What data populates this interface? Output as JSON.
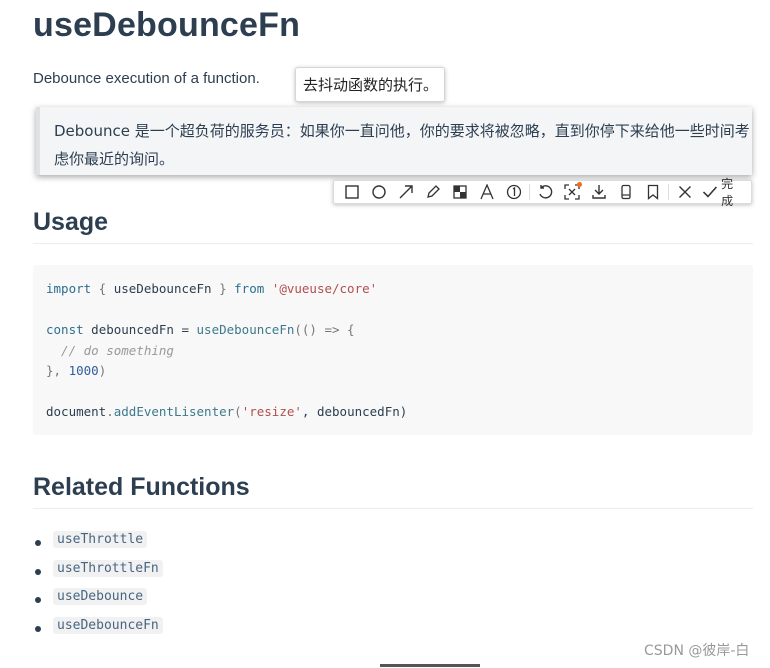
{
  "doc": {
    "title": "useDebounceFn",
    "description": "Debounce execution of a function.",
    "tooltip": "去抖动函数的执行。",
    "note": "Debounce 是一个超负荷的服务员：如果你一直问他，你的要求将被忽略，直到你停下来给他一些时间考虑你最近的询问。",
    "usage_heading": "Usage",
    "related_heading": "Related Functions",
    "related": [
      "useThrottle",
      "useThrottleFn",
      "useDebounce",
      "useDebounceFn"
    ]
  },
  "code": {
    "l1_kw": "import",
    "l1_a": " { ",
    "l1_id": "useDebounceFn",
    "l1_b": " } ",
    "l1_kw2": "from",
    "l1_str": "'@vueuse/core'",
    "l3_kw": "const",
    "l3_id": " debouncedFn = ",
    "l3_fn": "useDebounceFn",
    "l3_rest": "(() => {",
    "l4_cm": "  // do something",
    "l5_a": "}, ",
    "l5_num": "1000",
    "l5_b": ")",
    "l7_id": "document",
    "l7_dot": ".",
    "l7_fn": "addEventLisenter",
    "l7_a": "(",
    "l7_str": "'resize'",
    "l7_b": ", debouncedFn)"
  },
  "toolbar": {
    "done_label": "完成",
    "icons": [
      "rectangle-icon",
      "circle-icon",
      "arrow-icon",
      "pencil-icon",
      "mosaic-icon",
      "text-icon",
      "number-icon",
      "undo-icon",
      "ocr-icon",
      "download-icon",
      "pin-icon",
      "bookmark-icon",
      "close-icon",
      "check-icon"
    ]
  },
  "watermark": "CSDN @彼岸-白"
}
